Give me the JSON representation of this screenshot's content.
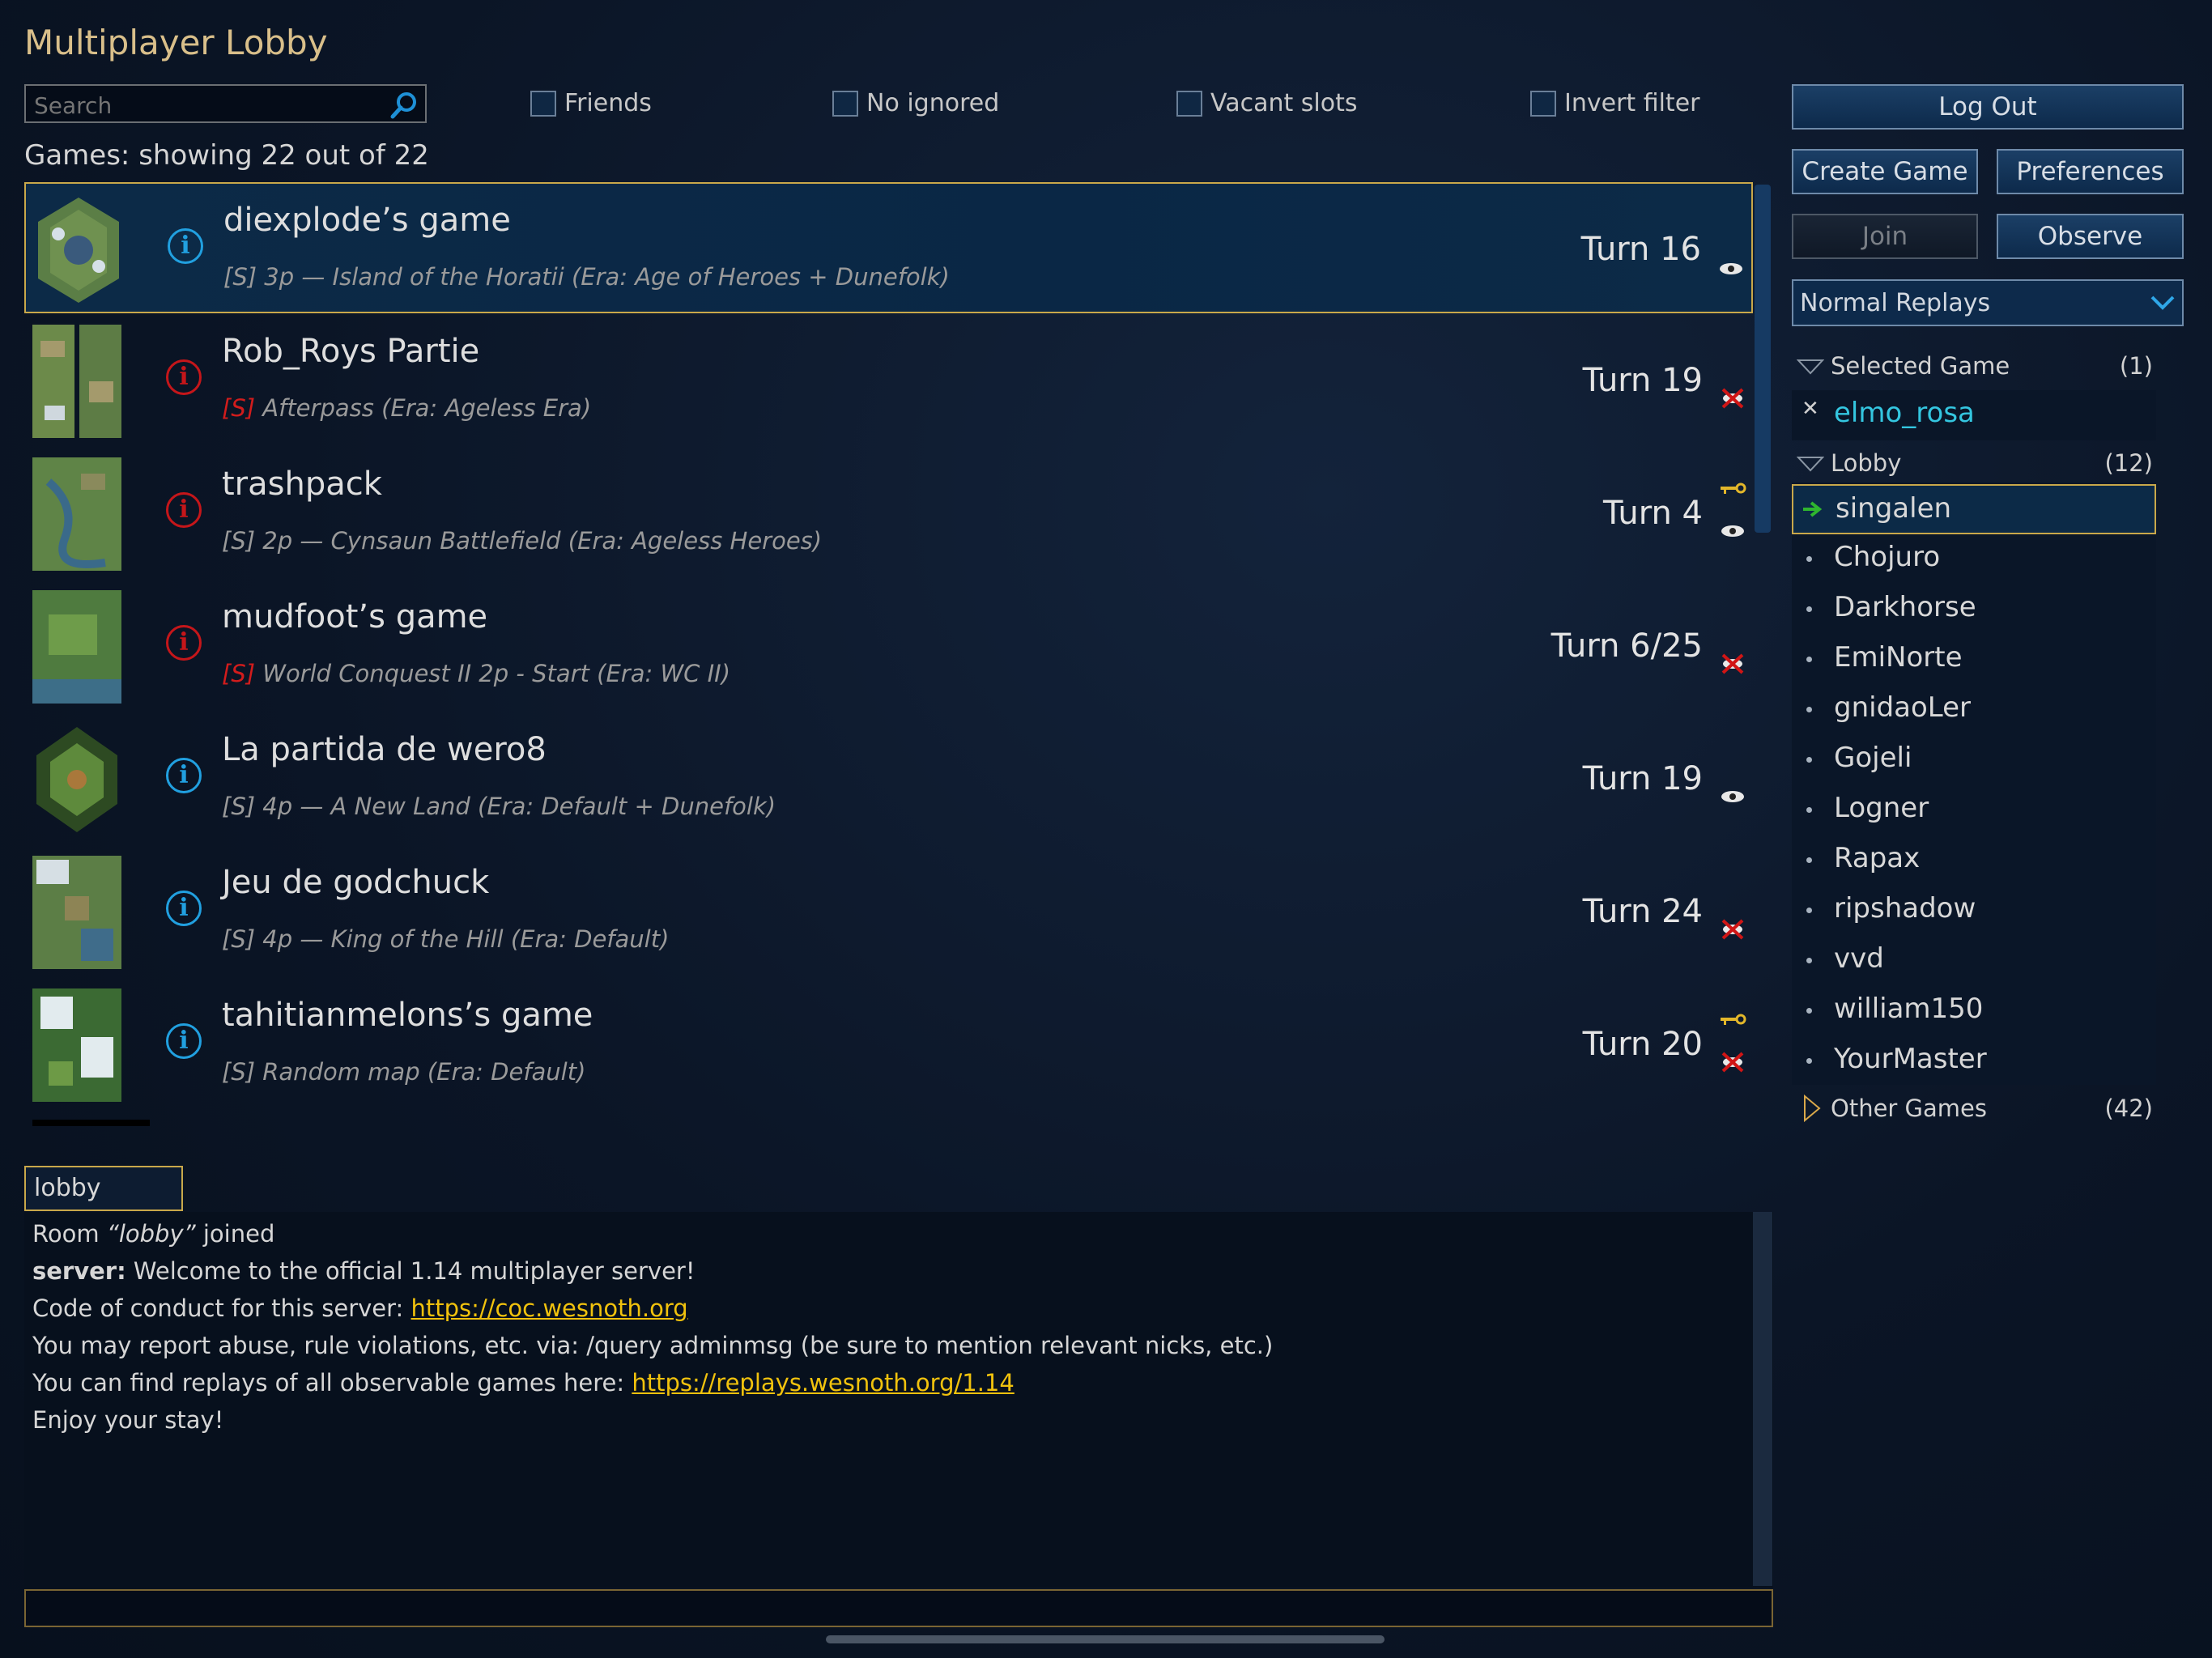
{
  "title": "Multiplayer Lobby",
  "search": {
    "placeholder": "Search"
  },
  "filters": {
    "friends": "Friends",
    "no_ignored": "No ignored",
    "vacant_slots": "Vacant slots",
    "invert_filter": "Invert filter"
  },
  "games_count": "Games: showing 22 out of 22",
  "games": [
    {
      "name": "diexplode’s game",
      "tag": "[S]",
      "desc": "3p — Island of the Horatii (Era: Age of Heroes + Dunefolk)",
      "turn": "Turn 16"
    },
    {
      "name": "Rob_Roys Partie",
      "tag": "[S]",
      "desc": "Afterpass (Era: Ageless Era)",
      "turn": "Turn 19"
    },
    {
      "name": "trashpack",
      "tag": "[S]",
      "desc": "2p — Cynsaun Battlefield (Era: Ageless Heroes)",
      "turn": "Turn 4"
    },
    {
      "name": "mudfoot’s game",
      "tag": "[S]",
      "desc": "World Conquest II 2p - Start (Era: WC II)",
      "turn": "Turn 6/25"
    },
    {
      "name": "La partida de wero8",
      "tag": "[S]",
      "desc": "4p — A New Land (Era: Default + Dunefolk)",
      "turn": "Turn 19"
    },
    {
      "name": "Jeu de godchuck",
      "tag": "[S]",
      "desc": "4p — King of the Hill (Era: Default)",
      "turn": "Turn 24"
    },
    {
      "name": "tahitianmelons’s game",
      "tag": "[S]",
      "desc": "Random map (Era: Default)",
      "turn": "Turn 20"
    }
  ],
  "chat": {
    "room_tab": "lobby",
    "room_joined_prefix": "Room ",
    "room_joined_name": "“lobby”",
    "room_joined_suffix": " joined",
    "server_label": "server:",
    "server_msg": " Welcome to the official 1.14 multiplayer server!",
    "coc_text": "Code of conduct for this server: ",
    "coc_link": "https://coc.wesnoth.org",
    "report_text": "You may report abuse, rule violations, etc. via: /query adminmsg (be sure to mention relevant nicks, etc.)",
    "replays_text": "You can find replays of all observable games here: ",
    "replays_link": "https://replays.wesnoth.org/1.14",
    "enjoy_text": "Enjoy your stay!"
  },
  "buttons": {
    "logout": "Log Out",
    "create_game": "Create Game",
    "preferences": "Preferences",
    "join": "Join",
    "observe": "Observe"
  },
  "replay_mode": "Normal Replays",
  "tree": {
    "selected_game": {
      "label": "Selected Game",
      "count": "(1)",
      "player": "elmo_rosa"
    },
    "lobby": {
      "label": "Lobby",
      "count": "(12)"
    },
    "other_games": {
      "label": "Other Games",
      "count": "(42)"
    }
  },
  "lobby_players": [
    "singalen",
    "Chojuro",
    "Darkhorse",
    "EmiNorte",
    "gnidaoLer",
    "Gojeli",
    "Logner",
    "Rapax",
    "ripshadow",
    "vvd",
    "william150",
    "YourMaster"
  ],
  "colors": {
    "accent_gold": "#c9a84a",
    "title_gold": "#d9bf8a",
    "info_blue": "#21a0e0",
    "tag_red": "#d21c1c",
    "link_yellow": "#f1c20d",
    "player_cyan": "#34c6e0",
    "arrow_green": "#2fb52f"
  }
}
